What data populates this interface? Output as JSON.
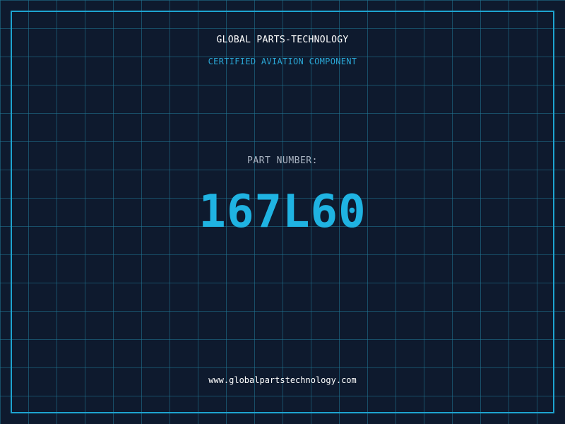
{
  "company": "GLOBAL PARTS-TECHNOLOGY",
  "subtitle": "CERTIFIED AVIATION COMPONENT",
  "part": {
    "label": "PART NUMBER:",
    "value": "167L60"
  },
  "website": "www.globalpartstechnology.com",
  "colors": {
    "background": "#0e1a2e",
    "grid": "#1f6f8b",
    "border": "#1ea4d0",
    "accent": "#1fb3e2",
    "label": "#aab4c2",
    "text": "#ffffff"
  }
}
